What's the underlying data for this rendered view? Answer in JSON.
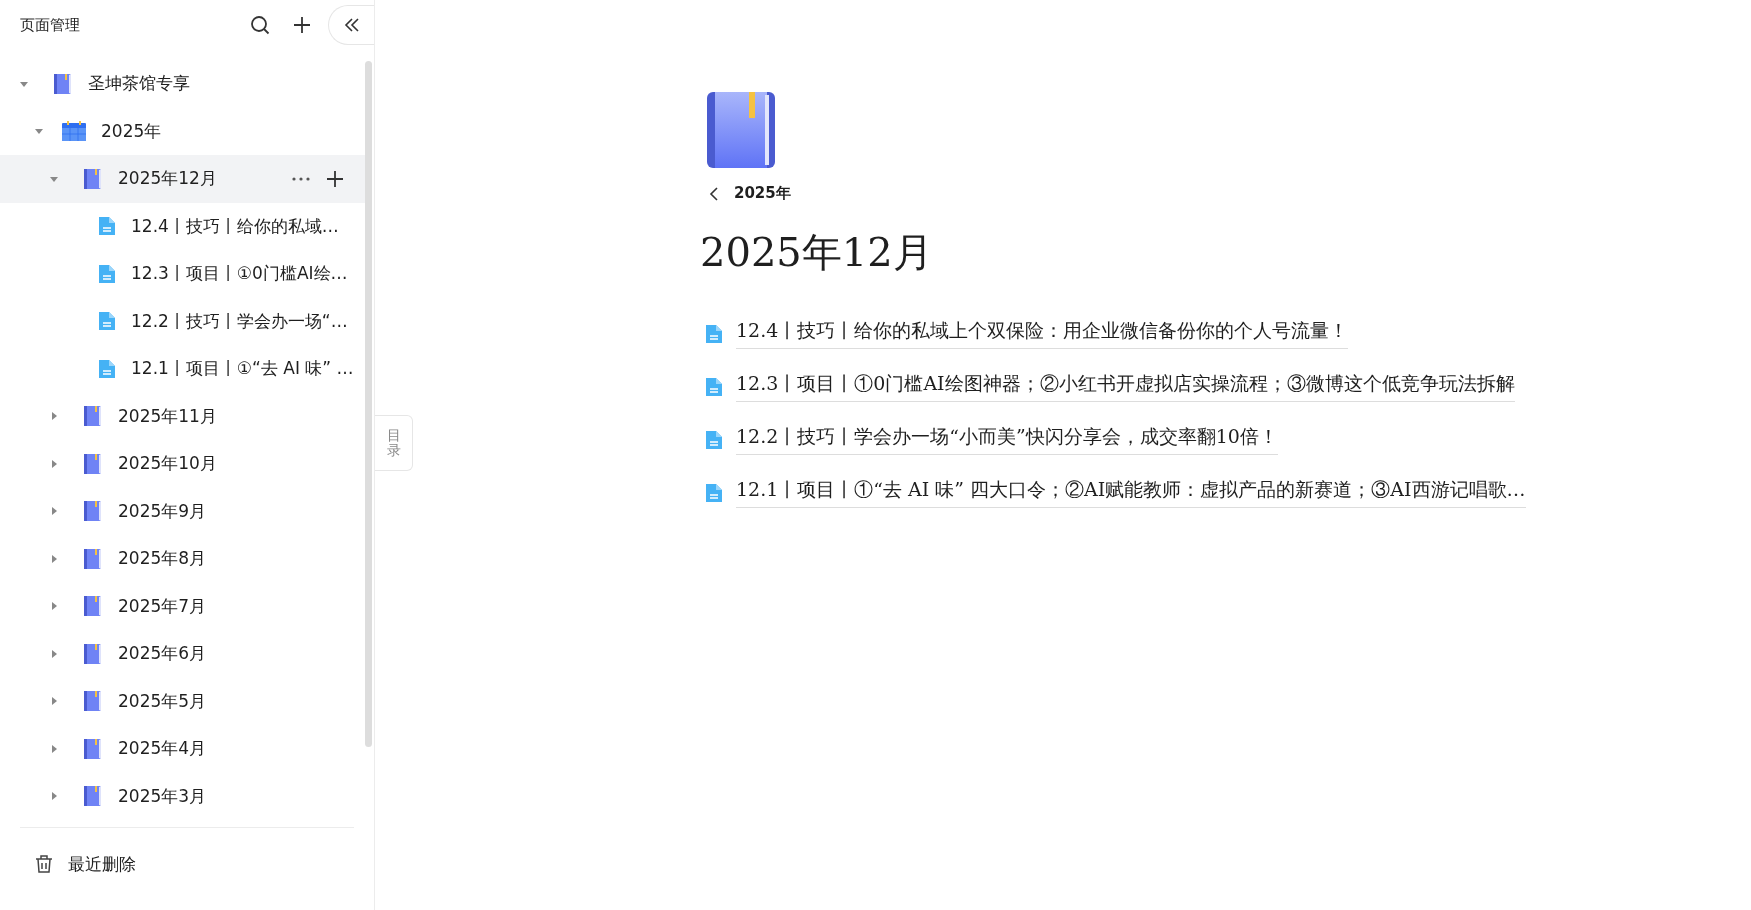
{
  "sidebar": {
    "title": "页面管理",
    "tree": [
      {
        "kind": "book",
        "label": "圣坤茶馆专享",
        "expanded": true,
        "selected": false,
        "children": [
          {
            "kind": "calendar",
            "label": "2025年",
            "expanded": true,
            "selected": false,
            "children": [
              {
                "kind": "book",
                "label": "2025年12月",
                "expanded": true,
                "selected": true,
                "children": [
                  {
                    "kind": "doc",
                    "label": "12.4丨技巧丨给你的私域…",
                    "selected": false
                  },
                  {
                    "kind": "doc",
                    "label": "12.3丨项目丨①0门槛AI绘…",
                    "selected": false
                  },
                  {
                    "kind": "doc",
                    "label": "12.2丨技巧丨学会办一场“…",
                    "selected": false
                  },
                  {
                    "kind": "doc",
                    "label": "12.1丨项目丨①“去 AI 味” …",
                    "selected": false
                  }
                ]
              },
              {
                "kind": "book",
                "label": "2025年11月",
                "expanded": false,
                "selected": false
              },
              {
                "kind": "book",
                "label": "2025年10月",
                "expanded": false,
                "selected": false
              },
              {
                "kind": "book",
                "label": "2025年9月",
                "expanded": false,
                "selected": false
              },
              {
                "kind": "book",
                "label": "2025年8月",
                "expanded": false,
                "selected": false
              },
              {
                "kind": "book",
                "label": "2025年7月",
                "expanded": false,
                "selected": false
              },
              {
                "kind": "book",
                "label": "2025年6月",
                "expanded": false,
                "selected": false
              },
              {
                "kind": "book",
                "label": "2025年5月",
                "expanded": false,
                "selected": false
              },
              {
                "kind": "book",
                "label": "2025年4月",
                "expanded": false,
                "selected": false
              },
              {
                "kind": "book",
                "label": "2025年3月",
                "expanded": false,
                "selected": false
              }
            ]
          }
        ]
      }
    ],
    "footer": {
      "label": "最近删除"
    }
  },
  "toc_tab": {
    "label": "目录"
  },
  "page": {
    "breadcrumb": "2025年",
    "title": "2025年12月",
    "links": [
      "12.4丨技巧丨给你的私域上个双保险：用企业微信备份你的个人号流量！",
      "12.3丨项目丨①0门槛AI绘图神器；②小红书开虚拟店实操流程；③微博这个低竞争玩法拆解",
      "12.2丨技巧丨学会办一场“小而美”快闪分享会，成交率翻10倍！",
      "12.1丨项目丨①“去 AI 味” 四大口令；②AI赋能教师：虚拟产品的新赛道；③AI西游记唱歌…"
    ]
  }
}
